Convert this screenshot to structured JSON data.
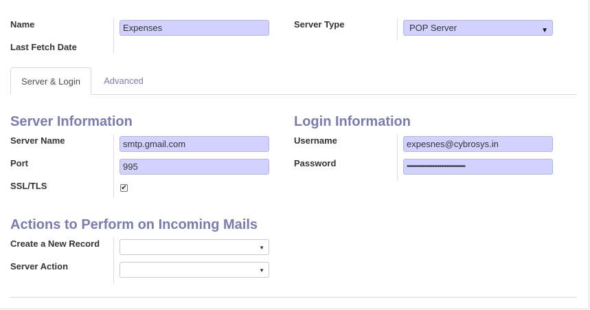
{
  "header": {
    "name_label": "Name",
    "name_value": "Expenses",
    "last_fetch_label": "Last Fetch Date",
    "server_type_label": "Server Type",
    "server_type_value": "POP Server",
    "server_type_caret": "▼"
  },
  "tabs": [
    {
      "label": "Server & Login",
      "active": true
    },
    {
      "label": "Advanced",
      "active": false
    }
  ],
  "server_info": {
    "title": "Server Information",
    "server_name_label": "Server Name",
    "server_name_value": "smtp.gmail.com",
    "port_label": "Port",
    "port_value": "995",
    "ssl_label": "SSL/TLS",
    "ssl_checked": true,
    "check_glyph": "✔"
  },
  "login_info": {
    "title": "Login Information",
    "username_label": "Username",
    "username_value": "expesnes@cybrosys.in",
    "password_label": "Password",
    "password_value": "••••••••••••••••••••••••••••••••••"
  },
  "actions": {
    "title": "Actions to Perform on Incoming Mails",
    "create_record_label": "Create a New Record",
    "create_record_value": "",
    "server_action_label": "Server Action",
    "server_action_value": "",
    "caret": "▼"
  },
  "colors": {
    "accent": "#7c7bad",
    "required_field_bg": "#d2d2ff"
  }
}
